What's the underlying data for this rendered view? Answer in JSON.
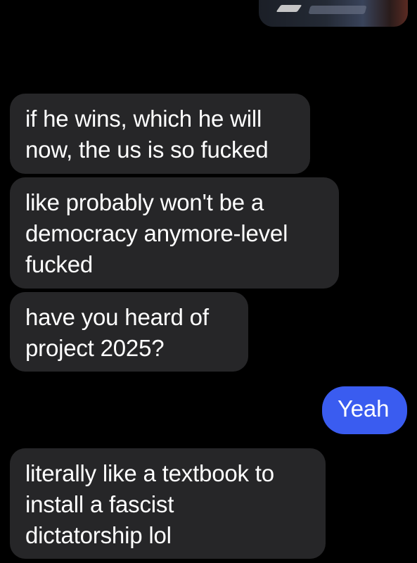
{
  "thread": {
    "tapback_reaction": "😞",
    "messages": [
      {
        "direction": "received",
        "text": "if he wins, which he will\nnow, the us is so fucked"
      },
      {
        "direction": "received",
        "text": "like probably won't be a\ndemocracy anymore-level\nfucked"
      },
      {
        "direction": "received",
        "text": "have you heard of\nproject 2025?"
      },
      {
        "direction": "sent",
        "text": "Yeah"
      },
      {
        "direction": "received",
        "text": "literally like a textbook to\ninstall a fascist\ndictatorship lol"
      }
    ]
  },
  "colors": {
    "background": "#000000",
    "received_bubble": "#262628",
    "sent_bubble": "#3a5cf0",
    "text": "#ffffff"
  },
  "icons": {
    "tapback": "disappointed-face-emoji"
  }
}
